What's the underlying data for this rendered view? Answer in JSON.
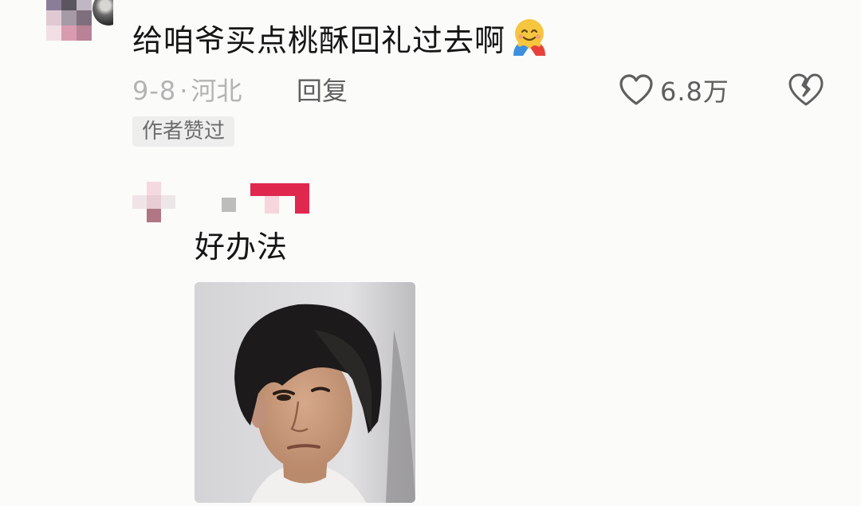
{
  "comment": {
    "text": "给咱爷买点桃酥回礼过去啊",
    "emoji": "hugging-face-emoji",
    "date": "9-8",
    "separator": "·",
    "location": "河北",
    "reply_label": "回复",
    "like_count": "6.8万",
    "author_badge": "作者赞过"
  },
  "reply": {
    "text": "好办法",
    "image": "person-with-long-fringe-photo"
  },
  "colors": {
    "background": "#fbfbf9",
    "primary_text": "#151515",
    "meta_text": "#b3b3b3",
    "action_text": "#5f5f5f",
    "badge_bg": "#eeeeee",
    "name_accent": "#e0284f"
  }
}
